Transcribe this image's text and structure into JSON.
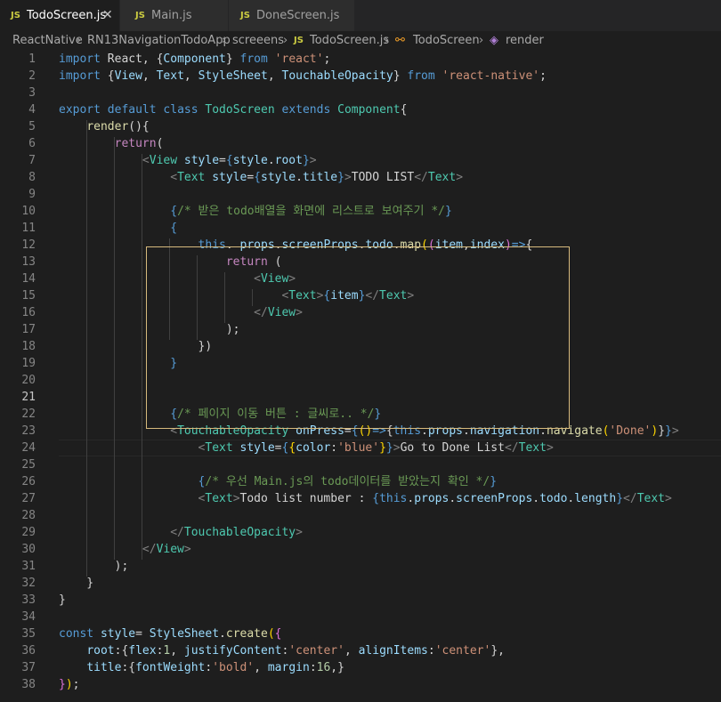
{
  "tabs": [
    {
      "label": "TodoScreen.js",
      "icon": "JS",
      "active": true
    },
    {
      "label": "Main.js",
      "icon": "JS",
      "active": false
    },
    {
      "label": "DoneScreen.js",
      "icon": "JS",
      "active": false
    }
  ],
  "breadcrumb": [
    "ReactNative",
    "RN13NavigationTodoApp",
    "screeens",
    "TodoScreen.js",
    "TodoScreen",
    "render"
  ],
  "lines": [
    [
      [
        "kw",
        "import"
      ],
      [
        "pn",
        " React, {"
      ],
      [
        "var",
        "Component"
      ],
      [
        "pn",
        "} "
      ],
      [
        "kw",
        "from"
      ],
      [
        "pn",
        " "
      ],
      [
        "str",
        "'react'"
      ],
      [
        "pn",
        ";"
      ]
    ],
    [
      [
        "kw",
        "import"
      ],
      [
        "pn",
        " {"
      ],
      [
        "var",
        "View"
      ],
      [
        "pn",
        ", "
      ],
      [
        "var",
        "Text"
      ],
      [
        "pn",
        ", "
      ],
      [
        "var",
        "StyleSheet"
      ],
      [
        "pn",
        ", "
      ],
      [
        "var",
        "TouchableOpacity"
      ],
      [
        "pn",
        "} "
      ],
      [
        "kw",
        "from"
      ],
      [
        "pn",
        " "
      ],
      [
        "str",
        "'react-native'"
      ],
      [
        "pn",
        ";"
      ]
    ],
    [],
    [
      [
        "kw",
        "export"
      ],
      [
        "pn",
        " "
      ],
      [
        "kw",
        "default"
      ],
      [
        "pn",
        " "
      ],
      [
        "kw",
        "class"
      ],
      [
        "pn",
        " "
      ],
      [
        "cls2",
        "TodoScreen"
      ],
      [
        "pn",
        " "
      ],
      [
        "kw",
        "extends"
      ],
      [
        "pn",
        " "
      ],
      [
        "cls2",
        "Component"
      ],
      [
        "pn",
        "{"
      ]
    ],
    [
      [
        "pn",
        "    "
      ],
      [
        "fn",
        "render"
      ],
      [
        "pn",
        "(){"
      ]
    ],
    [
      [
        "pn",
        "        "
      ],
      [
        "ctl",
        "return"
      ],
      [
        "pn",
        "("
      ]
    ],
    [
      [
        "pn",
        "            "
      ],
      [
        "tg",
        "<"
      ],
      [
        "cls2",
        "View"
      ],
      [
        "pn",
        " "
      ],
      [
        "var",
        "style"
      ],
      [
        "pn",
        "="
      ],
      [
        "kw",
        "{"
      ],
      [
        "var",
        "style"
      ],
      [
        "pn",
        "."
      ],
      [
        "var",
        "root"
      ],
      [
        "kw",
        "}"
      ],
      [
        "tg",
        ">"
      ]
    ],
    [
      [
        "pn",
        "                "
      ],
      [
        "tg",
        "<"
      ],
      [
        "cls2",
        "Text"
      ],
      [
        "pn",
        " "
      ],
      [
        "var",
        "style"
      ],
      [
        "pn",
        "="
      ],
      [
        "kw",
        "{"
      ],
      [
        "var",
        "style"
      ],
      [
        "pn",
        "."
      ],
      [
        "var",
        "title"
      ],
      [
        "kw",
        "}"
      ],
      [
        "tg",
        ">"
      ],
      [
        "pn",
        "TODO LIST"
      ],
      [
        "tg",
        "</"
      ],
      [
        "cls2",
        "Text"
      ],
      [
        "tg",
        ">"
      ]
    ],
    [],
    [
      [
        "pn",
        "                "
      ],
      [
        "kw",
        "{"
      ],
      [
        "cm",
        "/* 받은 todo배열을 화면에 리스트로 보여주기 */"
      ],
      [
        "kw",
        "}"
      ]
    ],
    [
      [
        "pn",
        "                "
      ],
      [
        "kw",
        "{"
      ]
    ],
    [
      [
        "pn",
        "                    "
      ],
      [
        "kw",
        "this"
      ],
      [
        "pn",
        ". "
      ],
      [
        "var",
        "props"
      ],
      [
        "pn",
        "."
      ],
      [
        "var",
        "screenProps"
      ],
      [
        "pn",
        "."
      ],
      [
        "var",
        "todo"
      ],
      [
        "pn",
        "."
      ],
      [
        "fn",
        "map"
      ],
      [
        "br",
        "("
      ],
      [
        "br2",
        "("
      ],
      [
        "var",
        "item"
      ],
      [
        "pn",
        ","
      ],
      [
        "var",
        "index"
      ],
      [
        "br2",
        ")"
      ],
      [
        "kw",
        "=>"
      ],
      [
        "pn",
        "{"
      ]
    ],
    [
      [
        "pn",
        "                        "
      ],
      [
        "ctl",
        "return"
      ],
      [
        "pn",
        " ("
      ]
    ],
    [
      [
        "pn",
        "                            "
      ],
      [
        "tg",
        "<"
      ],
      [
        "cls2",
        "View"
      ],
      [
        "tg",
        ">"
      ]
    ],
    [
      [
        "pn",
        "                                "
      ],
      [
        "tg",
        "<"
      ],
      [
        "cls2",
        "Text"
      ],
      [
        "tg",
        ">"
      ],
      [
        "kw",
        "{"
      ],
      [
        "var",
        "item"
      ],
      [
        "kw",
        "}"
      ],
      [
        "tg",
        "</"
      ],
      [
        "cls2",
        "Text"
      ],
      [
        "tg",
        ">"
      ]
    ],
    [
      [
        "pn",
        "                            "
      ],
      [
        "tg",
        "</"
      ],
      [
        "cls2",
        "View"
      ],
      [
        "tg",
        ">"
      ]
    ],
    [
      [
        "pn",
        "                        );"
      ]
    ],
    [
      [
        "pn",
        "                    })"
      ]
    ],
    [
      [
        "pn",
        "                "
      ],
      [
        "kw",
        "}"
      ]
    ],
    [],
    [],
    [
      [
        "pn",
        "                "
      ],
      [
        "kw",
        "{"
      ],
      [
        "cm",
        "/* 페이지 이동 버튼 : 글씨로.. */"
      ],
      [
        "kw",
        "}"
      ]
    ],
    [
      [
        "pn",
        "                "
      ],
      [
        "tg",
        "<"
      ],
      [
        "cls2",
        "TouchableOpacity"
      ],
      [
        "pn",
        " "
      ],
      [
        "var",
        "onPress"
      ],
      [
        "pn",
        "="
      ],
      [
        "kw",
        "{"
      ],
      [
        "br",
        "()"
      ],
      [
        "kw",
        "=>"
      ],
      [
        "pn",
        "{"
      ],
      [
        "kw",
        "this"
      ],
      [
        "pn",
        "."
      ],
      [
        "var",
        "props"
      ],
      [
        "pn",
        "."
      ],
      [
        "var",
        "navigation"
      ],
      [
        "pn",
        "."
      ],
      [
        "fn",
        "navigate"
      ],
      [
        "br",
        "("
      ],
      [
        "str",
        "'Done'"
      ],
      [
        "br",
        ")"
      ],
      [
        "pn",
        "}"
      ],
      [
        "kw",
        "}"
      ],
      [
        "tg",
        ">"
      ]
    ],
    [
      [
        "pn",
        "                    "
      ],
      [
        "tg",
        "<"
      ],
      [
        "cls2",
        "Text"
      ],
      [
        "pn",
        " "
      ],
      [
        "var",
        "style"
      ],
      [
        "pn",
        "="
      ],
      [
        "kw",
        "{"
      ],
      [
        "br",
        "{"
      ],
      [
        "var",
        "color"
      ],
      [
        "pn",
        ":"
      ],
      [
        "str",
        "'blue'"
      ],
      [
        "br",
        "}"
      ],
      [
        "kw",
        "}"
      ],
      [
        "tg",
        ">"
      ],
      [
        "pn",
        "Go to Done List"
      ],
      [
        "tg",
        "</"
      ],
      [
        "cls2",
        "Text"
      ],
      [
        "tg",
        ">"
      ]
    ],
    [],
    [
      [
        "pn",
        "                    "
      ],
      [
        "kw",
        "{"
      ],
      [
        "cm",
        "/* 우선 Main.js의 todo데이터를 받았는지 확인 */"
      ],
      [
        "kw",
        "}"
      ]
    ],
    [
      [
        "pn",
        "                    "
      ],
      [
        "tg",
        "<"
      ],
      [
        "cls2",
        "Text"
      ],
      [
        "tg",
        ">"
      ],
      [
        "pn",
        "Todo list number : "
      ],
      [
        "kw",
        "{"
      ],
      [
        "kw",
        "this"
      ],
      [
        "pn",
        "."
      ],
      [
        "var",
        "props"
      ],
      [
        "pn",
        "."
      ],
      [
        "var",
        "screenProps"
      ],
      [
        "pn",
        "."
      ],
      [
        "var",
        "todo"
      ],
      [
        "pn",
        "."
      ],
      [
        "var",
        "length"
      ],
      [
        "kw",
        "}"
      ],
      [
        "tg",
        "</"
      ],
      [
        "cls2",
        "Text"
      ],
      [
        "tg",
        ">"
      ]
    ],
    [],
    [
      [
        "pn",
        "                "
      ],
      [
        "tg",
        "</"
      ],
      [
        "cls2",
        "TouchableOpacity"
      ],
      [
        "tg",
        ">"
      ]
    ],
    [
      [
        "pn",
        "            "
      ],
      [
        "tg",
        "</"
      ],
      [
        "cls2",
        "View"
      ],
      [
        "tg",
        ">"
      ]
    ],
    [
      [
        "pn",
        "        );"
      ]
    ],
    [
      [
        "pn",
        "    }"
      ]
    ],
    [
      [
        "pn",
        "}"
      ]
    ],
    [],
    [
      [
        "kw",
        "const"
      ],
      [
        "pn",
        " "
      ],
      [
        "var",
        "style"
      ],
      [
        "pn",
        "= "
      ],
      [
        "var",
        "StyleSheet"
      ],
      [
        "pn",
        "."
      ],
      [
        "fn",
        "create"
      ],
      [
        "br",
        "("
      ],
      [
        "br2",
        "{"
      ]
    ],
    [
      [
        "pn",
        "    "
      ],
      [
        "var",
        "root"
      ],
      [
        "pn",
        ":{"
      ],
      [
        "var",
        "flex"
      ],
      [
        "pn",
        ":"
      ],
      [
        "num",
        "1"
      ],
      [
        "pn",
        ", "
      ],
      [
        "var",
        "justifyContent"
      ],
      [
        "pn",
        ":"
      ],
      [
        "str",
        "'center'"
      ],
      [
        "pn",
        ", "
      ],
      [
        "var",
        "alignItems"
      ],
      [
        "pn",
        ":"
      ],
      [
        "str",
        "'center'"
      ],
      [
        "pn",
        "},"
      ]
    ],
    [
      [
        "pn",
        "    "
      ],
      [
        "var",
        "title"
      ],
      [
        "pn",
        ":{"
      ],
      [
        "var",
        "fontWeight"
      ],
      [
        "pn",
        ":"
      ],
      [
        "str",
        "'bold'"
      ],
      [
        "pn",
        ", "
      ],
      [
        "var",
        "margin"
      ],
      [
        "pn",
        ":"
      ],
      [
        "num",
        "16"
      ],
      [
        "pn",
        ",}"
      ]
    ],
    [
      [
        "br2",
        "}"
      ],
      [
        "br",
        ")"
      ],
      [
        "pn",
        ";"
      ]
    ]
  ]
}
